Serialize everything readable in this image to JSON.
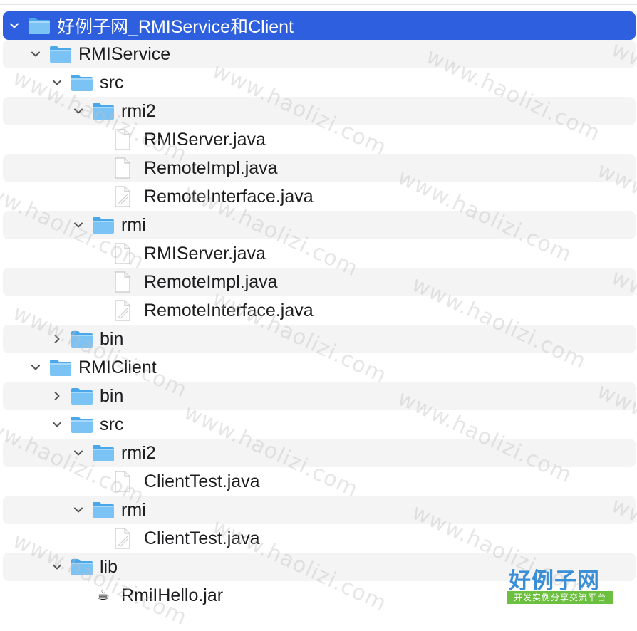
{
  "colors": {
    "selection": "#2d5fde",
    "folder_front": "#7cc3f5",
    "folder_back": "#4aa7ea",
    "alt_row": "#f4f4f5",
    "text": "#1d1d1f",
    "watermark_logo_blue": "#3a8fd6",
    "watermark_logo_green": "#6cbf3f"
  },
  "tree": [
    {
      "label": "好例子网_RMIService和Client",
      "type": "folder",
      "depth": 0,
      "expanded": true,
      "selected": true,
      "name": "root-folder"
    },
    {
      "label": "RMIService",
      "type": "folder",
      "depth": 1,
      "expanded": true,
      "name": "rmiservice-folder"
    },
    {
      "label": "src",
      "type": "folder",
      "depth": 2,
      "expanded": true,
      "name": "rmiservice-src-folder"
    },
    {
      "label": "rmi2",
      "type": "folder",
      "depth": 3,
      "expanded": true,
      "name": "rmiservice-rmi2-folder"
    },
    {
      "label": "RMIServer.java",
      "type": "file",
      "depth": 4,
      "name": "rmi2-rmiserver-file"
    },
    {
      "label": "RemoteImpl.java",
      "type": "file",
      "depth": 4,
      "name": "rmi2-remoteimpl-file"
    },
    {
      "label": "RemoteInterface.java",
      "type": "file-alias",
      "depth": 4,
      "name": "rmi2-remoteinterface-file"
    },
    {
      "label": "rmi",
      "type": "folder",
      "depth": 3,
      "expanded": true,
      "name": "rmiservice-rmi-folder"
    },
    {
      "label": "RMIServer.java",
      "type": "file",
      "depth": 4,
      "name": "rmi-rmiserver-file"
    },
    {
      "label": "RemoteImpl.java",
      "type": "file",
      "depth": 4,
      "name": "rmi-remoteimpl-file"
    },
    {
      "label": "RemoteInterface.java",
      "type": "file-alias",
      "depth": 4,
      "name": "rmi-remoteinterface-file"
    },
    {
      "label": "bin",
      "type": "folder",
      "depth": 2,
      "expanded": false,
      "name": "rmiservice-bin-folder"
    },
    {
      "label": "RMIClient",
      "type": "folder",
      "depth": 1,
      "expanded": true,
      "name": "rmiclient-folder"
    },
    {
      "label": "bin",
      "type": "folder",
      "depth": 2,
      "expanded": false,
      "name": "rmiclient-bin-folder"
    },
    {
      "label": "src",
      "type": "folder",
      "depth": 2,
      "expanded": true,
      "name": "rmiclient-src-folder"
    },
    {
      "label": "rmi2",
      "type": "folder",
      "depth": 3,
      "expanded": true,
      "name": "rmiclient-rmi2-folder"
    },
    {
      "label": "ClientTest.java",
      "type": "file",
      "depth": 4,
      "name": "rmi2-clienttest-file"
    },
    {
      "label": "rmi",
      "type": "folder",
      "depth": 3,
      "expanded": true,
      "name": "rmiclient-rmi-folder"
    },
    {
      "label": "ClientTest.java",
      "type": "file-alias",
      "depth": 4,
      "name": "rmi-clienttest-file"
    },
    {
      "label": "lib",
      "type": "folder",
      "depth": 2,
      "expanded": true,
      "name": "rmiclient-lib-folder"
    },
    {
      "label": "RmiIHello.jar",
      "type": "jar",
      "depth": 3,
      "name": "rmihello-jar-file"
    }
  ],
  "watermark": {
    "text": "www.haolizi.com",
    "logo_title": "好例子网",
    "logo_subtitle": "开发实例分享交流平台"
  }
}
